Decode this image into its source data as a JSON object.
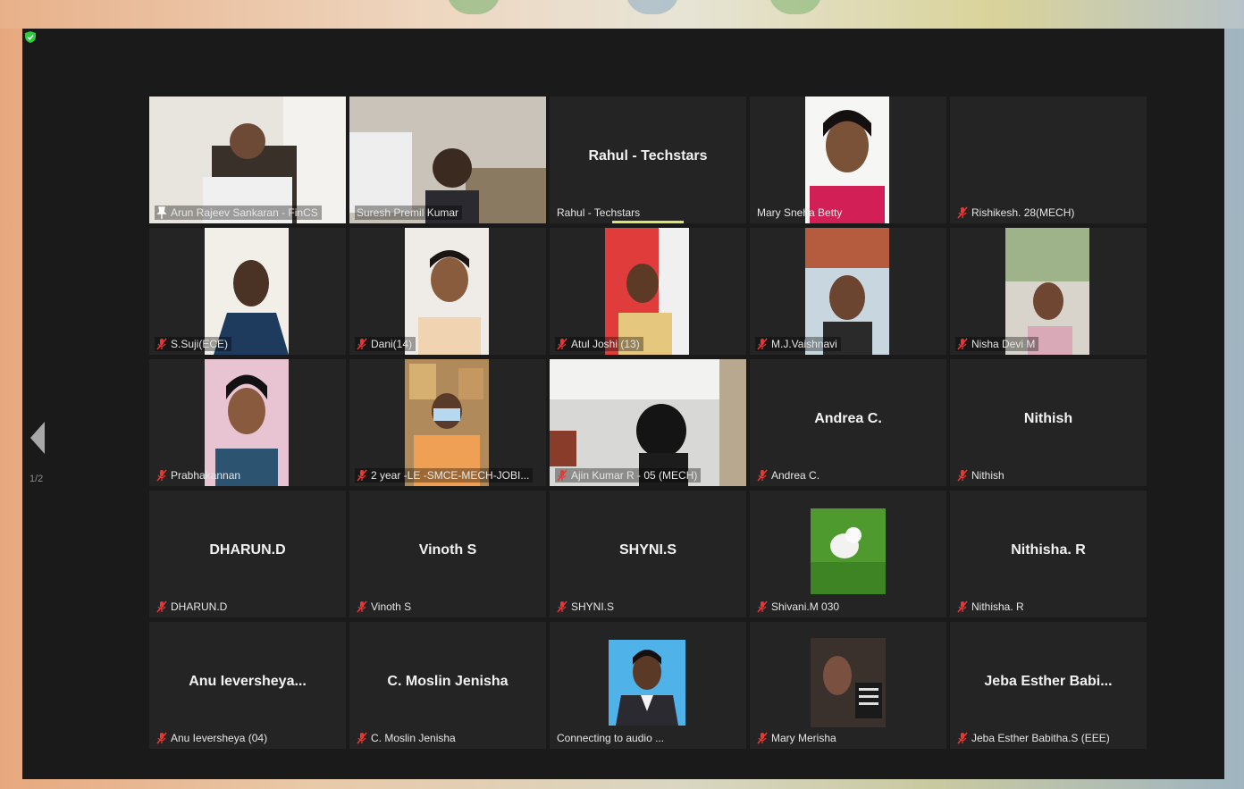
{
  "meeting": {
    "page_indicator": "1/2",
    "active_speaker_color": "#d9e56b",
    "mute_color": "#e53935"
  },
  "participants": [
    {
      "display": "",
      "label": "Arun Rajeev Sankaran - FinCS",
      "muted": false,
      "pinned": true,
      "video": true,
      "active": true
    },
    {
      "display": "",
      "label": "Suresh Premil Kumar",
      "muted": false,
      "video": true
    },
    {
      "display": "Rahul - Techstars",
      "label": "Rahul - Techstars",
      "muted": false,
      "video": false,
      "speaking": true
    },
    {
      "display": "",
      "label": "Mary Sneha Betty",
      "muted": false,
      "video": true
    },
    {
      "display": "",
      "label": "Rishikesh. 28(MECH)",
      "muted": true,
      "video": false
    },
    {
      "display": "",
      "label": "S.Suji(ECE)",
      "muted": true,
      "video": true
    },
    {
      "display": "",
      "label": "Dani(14)",
      "muted": true,
      "video": true
    },
    {
      "display": "",
      "label": "Atul Joshi (13)",
      "muted": true,
      "video": true
    },
    {
      "display": "",
      "label": "M.J.Vaishnavi",
      "muted": true,
      "video": true
    },
    {
      "display": "",
      "label": "Nisha Devi M",
      "muted": true,
      "video": true
    },
    {
      "display": "",
      "label": "Prabhakannan",
      "muted": true,
      "video": true
    },
    {
      "display": "",
      "label": "2 year -LE -SMCE-MECH-JOBI...",
      "muted": true,
      "video": true
    },
    {
      "display": "",
      "label": "Ajin Kumar R - 05 (MECH)",
      "muted": true,
      "video": true
    },
    {
      "display": "Andrea C.",
      "label": "Andrea C.",
      "muted": true,
      "video": false
    },
    {
      "display": "Nithish",
      "label": "Nithish",
      "muted": true,
      "video": false
    },
    {
      "display": "DHARUN.D",
      "label": "DHARUN.D",
      "muted": true,
      "video": false
    },
    {
      "display": "Vinoth S",
      "label": "Vinoth S",
      "muted": true,
      "video": false
    },
    {
      "display": "SHYNI.S",
      "label": "SHYNI.S",
      "muted": true,
      "video": false
    },
    {
      "display": "",
      "label": "Shivani.M 030",
      "muted": true,
      "video": true
    },
    {
      "display": "Nithisha. R",
      "label": "Nithisha. R",
      "muted": true,
      "video": false
    },
    {
      "display": "Anu Ieversheya...",
      "label": "Anu Ieversheya (04)",
      "muted": true,
      "video": false
    },
    {
      "display": "C. Moslin Jenisha",
      "label": "C. Moslin Jenisha",
      "muted": true,
      "video": false
    },
    {
      "display": "",
      "label": "Connecting to audio ...",
      "muted": false,
      "video": true
    },
    {
      "display": "",
      "label": "Mary Merisha",
      "muted": true,
      "video": true
    },
    {
      "display": "Jeba Esther Babi...",
      "label": "Jeba Esther Babitha.S (EEE)",
      "muted": true,
      "video": false
    }
  ]
}
